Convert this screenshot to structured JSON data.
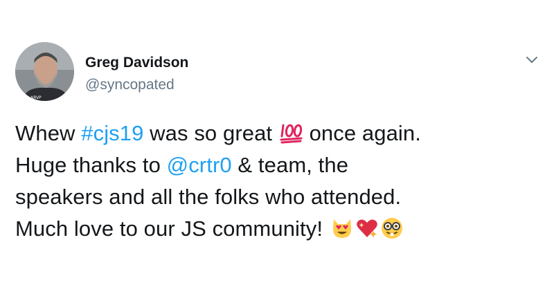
{
  "author": {
    "name": "Greg Davidson",
    "handle": "@syncopated"
  },
  "tweet": {
    "line1": {
      "pre": "Whew ",
      "hashtag": "#cjs19",
      "mid": " was so great ",
      "emoji": "hundred-points-icon",
      "post": " once again."
    },
    "line2": {
      "pre": "Huge thanks to ",
      "mention": "@crtr0",
      "post": " & team, the"
    },
    "line3": {
      "text": "speakers and all the folks who attended."
    },
    "line4": {
      "text": "Much love to our JS community! ",
      "emojis": [
        "heart-eyes-cat-icon",
        "sparkling-heart-icon",
        "nerd-face-icon"
      ]
    }
  },
  "colors": {
    "text": "#14171a",
    "link": "#1da1f2",
    "handle": "#657786",
    "caret": "#657786"
  }
}
